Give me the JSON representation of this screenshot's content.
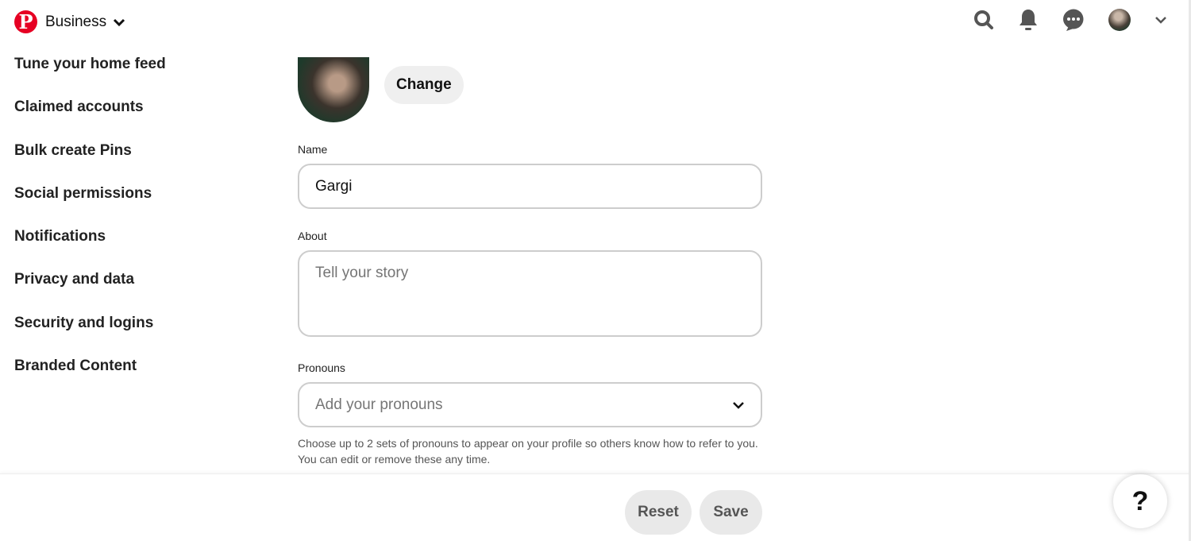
{
  "header": {
    "brand_label": "Business",
    "logo_letter": "P",
    "brand_color": "#e60023",
    "icons": [
      "search-icon",
      "bell-icon",
      "chat-icon",
      "avatar",
      "chevron-down-icon"
    ]
  },
  "sidebar": {
    "items": [
      {
        "label": "Tune your home feed"
      },
      {
        "label": "Claimed accounts"
      },
      {
        "label": "Bulk create Pins"
      },
      {
        "label": "Social permissions"
      },
      {
        "label": "Notifications"
      },
      {
        "label": "Privacy and data"
      },
      {
        "label": "Security and logins"
      },
      {
        "label": "Branded Content"
      }
    ]
  },
  "profile": {
    "change_label": "Change",
    "name_label": "Name",
    "name_value": "Gargi",
    "about_label": "About",
    "about_placeholder": "Tell your story",
    "pronouns_label": "Pronouns",
    "pronouns_placeholder": "Add your pronouns",
    "pronouns_help": "Choose up to 2 sets of pronouns to appear on your profile so others know how to refer to you. You can edit or remove these any time."
  },
  "footer": {
    "reset_label": "Reset",
    "save_label": "Save",
    "help_label": "?"
  }
}
